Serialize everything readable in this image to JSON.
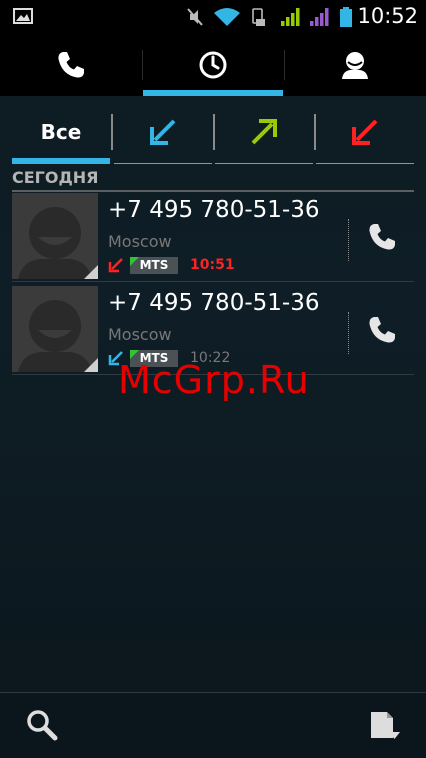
{
  "status_bar": {
    "time": "10:52",
    "icons": [
      "gallery-icon",
      "mute-icon",
      "wifi-icon",
      "usb-icon",
      "signal-green-icon",
      "signal-purple-icon",
      "battery-icon"
    ]
  },
  "top_tabs": [
    {
      "name": "phone-tab",
      "icon": "phone-icon",
      "active": false
    },
    {
      "name": "call-log-tab",
      "icon": "clock-icon",
      "active": true
    },
    {
      "name": "contacts-tab",
      "icon": "person-icon",
      "active": false
    }
  ],
  "filters": {
    "all_label": "Все",
    "items": [
      {
        "name": "filter-all",
        "active": true
      },
      {
        "name": "filter-incoming",
        "icon": "incoming-arrow-icon",
        "color": "#33b5e5"
      },
      {
        "name": "filter-outgoing",
        "icon": "outgoing-arrow-icon",
        "color": "#99cc00"
      },
      {
        "name": "filter-missed",
        "icon": "missed-arrow-icon",
        "color": "#ff2222"
      }
    ]
  },
  "section": {
    "title": "СЕГОДНЯ"
  },
  "calls": [
    {
      "number": "+7 495 780-51-36",
      "location": "Moscow",
      "sim": "MTS",
      "time": "10:51",
      "type": "missed",
      "time_color": "#ff2222"
    },
    {
      "number": "+7 495 780-51-36",
      "location": "Moscow",
      "sim": "MTS",
      "time": "10:22",
      "type": "incoming",
      "time_color": "#777777"
    }
  ],
  "watermark": "McGrp.Ru",
  "colors": {
    "accent": "#33b5e5",
    "missed": "#ff2222",
    "outgoing": "#99cc00"
  }
}
